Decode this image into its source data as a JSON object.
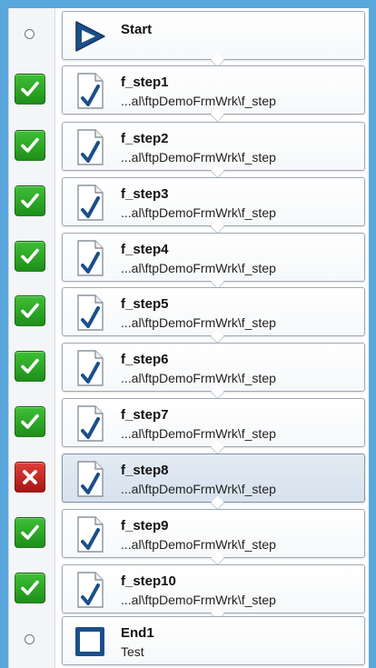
{
  "steps": [
    {
      "title": "Start",
      "sub": "",
      "status": "none",
      "icon": "start-arrow-icon"
    },
    {
      "title": "f_step1",
      "sub": "...al\\ftpDemoFrmWrk\\f_step",
      "status": "ok",
      "icon": "document-check-icon"
    },
    {
      "title": "f_step2",
      "sub": "...al\\ftpDemoFrmWrk\\f_step",
      "status": "ok",
      "icon": "document-check-icon"
    },
    {
      "title": "f_step3",
      "sub": "...al\\ftpDemoFrmWrk\\f_step",
      "status": "ok",
      "icon": "document-check-icon"
    },
    {
      "title": "f_step4",
      "sub": "...al\\ftpDemoFrmWrk\\f_step",
      "status": "ok",
      "icon": "document-check-icon"
    },
    {
      "title": "f_step5",
      "sub": "...al\\ftpDemoFrmWrk\\f_step",
      "status": "ok",
      "icon": "document-check-icon"
    },
    {
      "title": "f_step6",
      "sub": "...al\\ftpDemoFrmWrk\\f_step",
      "status": "ok",
      "icon": "document-check-icon"
    },
    {
      "title": "f_step7",
      "sub": "...al\\ftpDemoFrmWrk\\f_step",
      "status": "ok",
      "icon": "document-check-icon"
    },
    {
      "title": "f_step8",
      "sub": "...al\\ftpDemoFrmWrk\\f_step",
      "status": "fail",
      "icon": "document-check-icon",
      "selected": true
    },
    {
      "title": "f_step9",
      "sub": "...al\\ftpDemoFrmWrk\\f_step",
      "status": "ok",
      "icon": "document-check-icon"
    },
    {
      "title": "f_step10",
      "sub": "...al\\ftpDemoFrmWrk\\f_step",
      "status": "ok",
      "icon": "document-check-icon"
    },
    {
      "title": "End1",
      "sub": "Test",
      "status": "none",
      "icon": "end-square-icon"
    }
  ],
  "colors": {
    "background": "#5aa7dc",
    "ok": "#2aa524",
    "fail": "#c2201c",
    "selected": "#dce6f1",
    "icon_blue": "#1b4f8a"
  }
}
